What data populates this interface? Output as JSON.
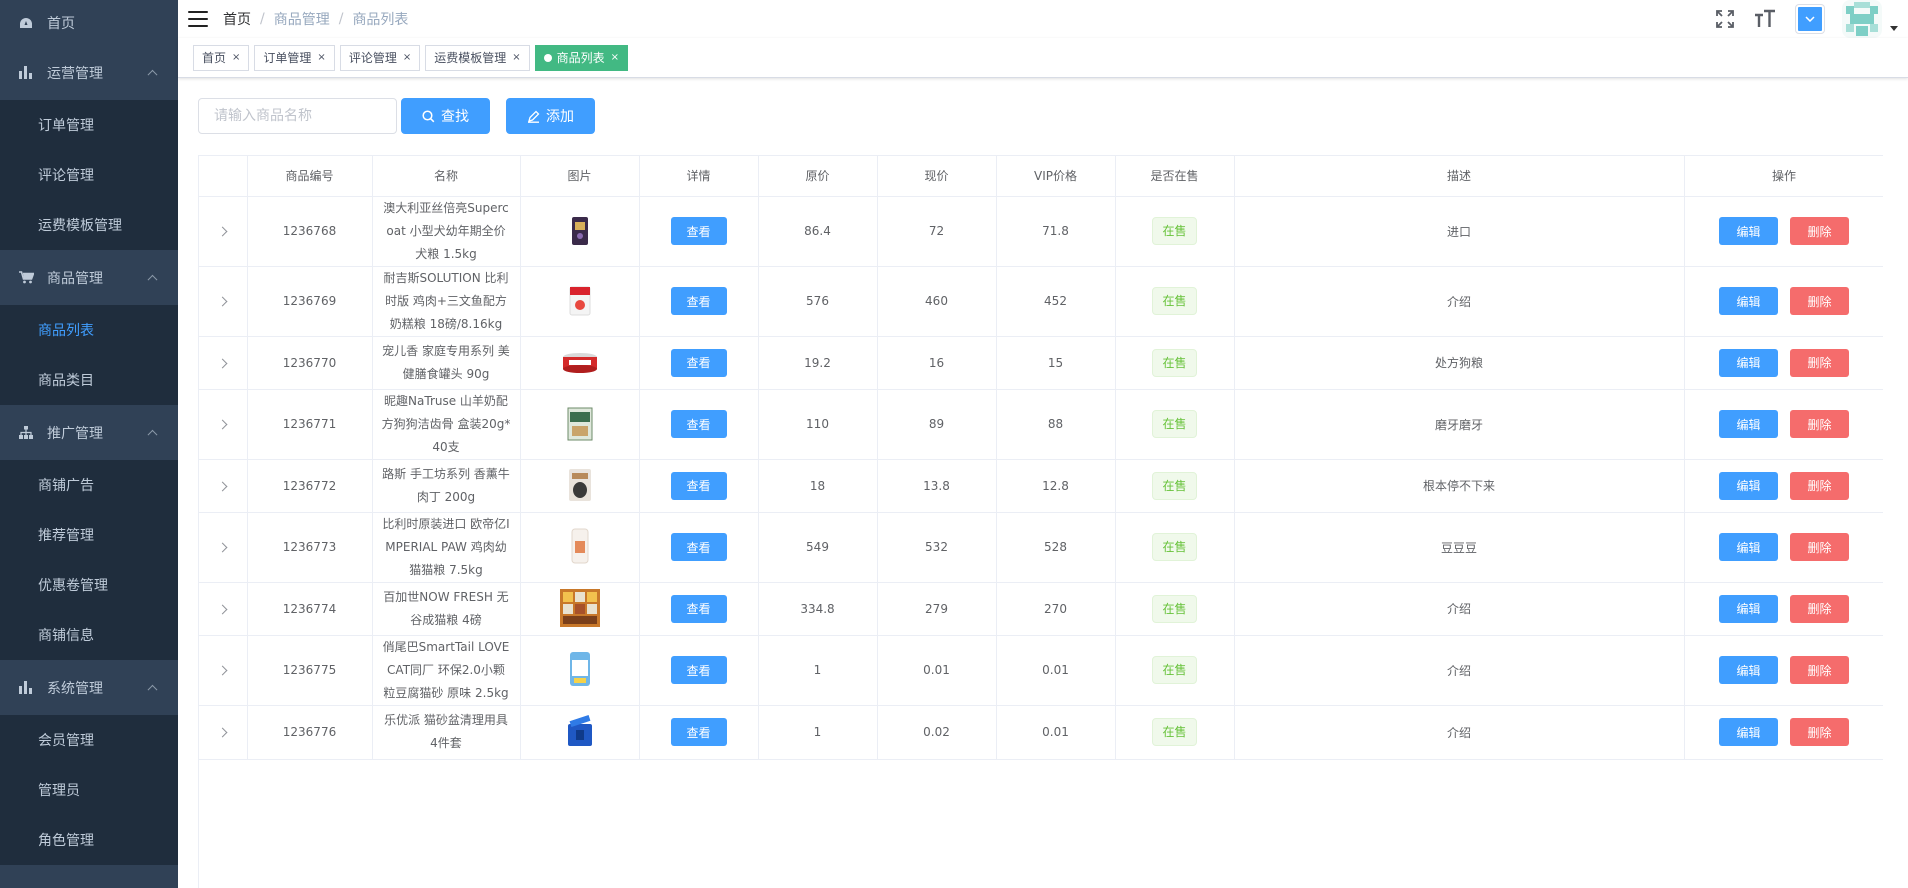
{
  "sidebar": {
    "home": {
      "label": "首页",
      "icon": "dashboard-icon"
    },
    "groups": [
      {
        "label": "运营管理",
        "icon": "bar-chart-icon",
        "items": [
          "订单管理",
          "评论管理",
          "运费模板管理"
        ]
      },
      {
        "label": "商品管理",
        "icon": "shopping-cart-icon",
        "items": [
          "商品列表",
          "商品类目"
        ],
        "active_item": "商品列表"
      },
      {
        "label": "推广管理",
        "icon": "sitemap-icon",
        "items": [
          "商铺广告",
          "推荐管理",
          "优惠卷管理",
          "商铺信息"
        ]
      },
      {
        "label": "系统管理",
        "icon": "bar-chart-icon",
        "items": [
          "会员管理",
          "管理员",
          "角色管理"
        ]
      }
    ]
  },
  "header": {
    "breadcrumb": [
      "首页",
      "商品管理",
      "商品列表"
    ],
    "separator": "/"
  },
  "tags": [
    {
      "label": "首页",
      "active": false
    },
    {
      "label": "订单管理",
      "active": false
    },
    {
      "label": "评论管理",
      "active": false
    },
    {
      "label": "运费模板管理",
      "active": false
    },
    {
      "label": "商品列表",
      "active": true
    }
  ],
  "tag_close": "×",
  "filter": {
    "placeholder": "请输入商品名称",
    "search_label": "查找",
    "add_label": "添加"
  },
  "table": {
    "columns": [
      "",
      "商品编号",
      "名称",
      "图片",
      "详情",
      "原价",
      "现价",
      "VIP价格",
      "是否在售",
      "描述",
      "操作"
    ],
    "view_label": "查看",
    "edit_label": "编辑",
    "delete_label": "删除",
    "rows": [
      {
        "id": "1236768",
        "name": "澳大利亚丝倍亮Supercoat 小型犬幼年期全价犬粮 1.5kg",
        "original": "86.4",
        "current": "72",
        "vip": "71.8",
        "status": "在售",
        "desc": "进口",
        "img": "dark-bag"
      },
      {
        "id": "1236769",
        "name": "耐吉斯SOLUTION 比利时版 鸡肉+三文鱼配方奶糕粮 18磅/8.16kg",
        "original": "576",
        "current": "460",
        "vip": "452",
        "status": "在售",
        "desc": "介绍",
        "img": "red-bag"
      },
      {
        "id": "1236770",
        "name": "宠儿香 家庭专用系列 美健膳食罐头 90g",
        "original": "19.2",
        "current": "16",
        "vip": "15",
        "status": "在售",
        "desc": "处方狗粮",
        "img": "can"
      },
      {
        "id": "1236771",
        "name": "昵趣NaTruse 山羊奶配方狗狗洁齿骨 盒装20g*40支",
        "original": "110",
        "current": "89",
        "vip": "88",
        "status": "在售",
        "desc": "磨牙磨牙",
        "img": "green-box"
      },
      {
        "id": "1236772",
        "name": "路斯 手工坊系列 香薰牛肉丁 200g",
        "original": "18",
        "current": "13.8",
        "vip": "12.8",
        "status": "在售",
        "desc": "根本停不下来",
        "img": "pouch"
      },
      {
        "id": "1236773",
        "name": "比利时原装进口 欧帝亿IMPERIAL PAW 鸡肉幼猫猫粮 7.5kg",
        "original": "549",
        "current": "532",
        "vip": "528",
        "status": "在售",
        "desc": "豆豆豆",
        "img": "white-bag"
      },
      {
        "id": "1236774",
        "name": "百加世NOW FRESH 无谷成猫粮 4磅",
        "original": "334.8",
        "current": "279",
        "vip": "270",
        "status": "在售",
        "desc": "介绍",
        "img": "orange-grid"
      },
      {
        "id": "1236775",
        "name": "俏尾巴SmartTail LOVE CAT同厂 环保2.0小颗粒豆腐猫砂 原味 2.5kg",
        "original": "1",
        "current": "0.01",
        "vip": "0.01",
        "status": "在售",
        "desc": "介绍",
        "img": "blue-bag"
      },
      {
        "id": "1236776",
        "name": "乐优派 猫砂盆清理用具4件套",
        "original": "1",
        "current": "0.02",
        "vip": "0.01",
        "status": "在售",
        "desc": "介绍",
        "img": "blue-bin"
      }
    ]
  },
  "colors": {
    "sidebar_bg": "#304156",
    "submenu_bg": "#1f2d3d",
    "primary": "#409eff",
    "danger": "#f56c6c",
    "success_tag": "#42b983"
  }
}
